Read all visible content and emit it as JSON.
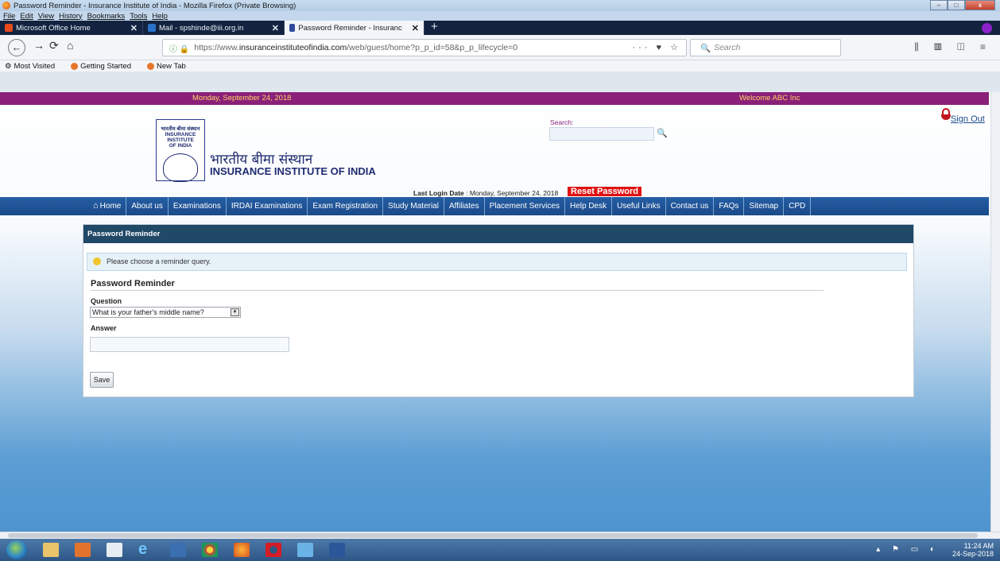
{
  "window": {
    "title": "Password Reminder - Insurance Institute of India - Mozilla Firefox (Private Browsing)",
    "menu": [
      "File",
      "Edit",
      "View",
      "History",
      "Bookmarks",
      "Tools",
      "Help"
    ]
  },
  "tabs": [
    {
      "label": "Microsoft Office Home",
      "color": "#e84a1e"
    },
    {
      "label": "Mail - spshinde@iii.org.in",
      "color": "#2a72c9"
    },
    {
      "label": "Password Reminder - Insuranc",
      "color": "#2e4a9a"
    }
  ],
  "toolbar": {
    "url_prefix": "https://www.",
    "url_domain": "insuranceinstituteofindia.com",
    "url_rest": "/web/guest/home?p_p_id=58&p_p_lifecycle=0",
    "url_actions": "··· ♥ ☆",
    "search_placeholder": "Search"
  },
  "bookmarks": [
    "Most Visited",
    "Getting Started",
    "New Tab"
  ],
  "site": {
    "date": "Monday, September 24, 2018",
    "welcome": "Welcome ABC Inc",
    "logo_text": "भारतीय बीमा संस्थान INSURANCE INSTITUTE OF INDIA",
    "name_hindi": "भारतीय बीमा संस्थान",
    "name_english": "INSURANCE INSTITUTE OF INDIA",
    "search_label": "Search:",
    "sign_out": "Sign Out",
    "last_login_label": "Last Login Date",
    "last_login_value": " : Monday, September 24, 2018",
    "reset_password": "Reset Password"
  },
  "nav": [
    "Home",
    "About us",
    "Examinations",
    "IRDAI Examinations",
    "Exam Registration",
    "Study Material",
    "Affiliates",
    "Placement Services",
    "Help Desk",
    "Useful Links",
    "Contact us",
    "FAQs",
    "Sitemap",
    "CPD"
  ],
  "portlet": {
    "header": "Password Reminder",
    "info": "Please choose a reminder query.",
    "section_title": "Password Reminder",
    "question_label": "Question",
    "question_value": "What is your father's middle name?",
    "answer_label": "Answer",
    "answer_value": "",
    "save_label": "Save"
  },
  "taskbar": {
    "time": "11:24 AM",
    "date": "24-Sep-2018"
  },
  "colors": {
    "top_strip": "#8a2079",
    "nav": "#1f56a0",
    "reset": "#e01313",
    "portlet_header": "#204867"
  }
}
